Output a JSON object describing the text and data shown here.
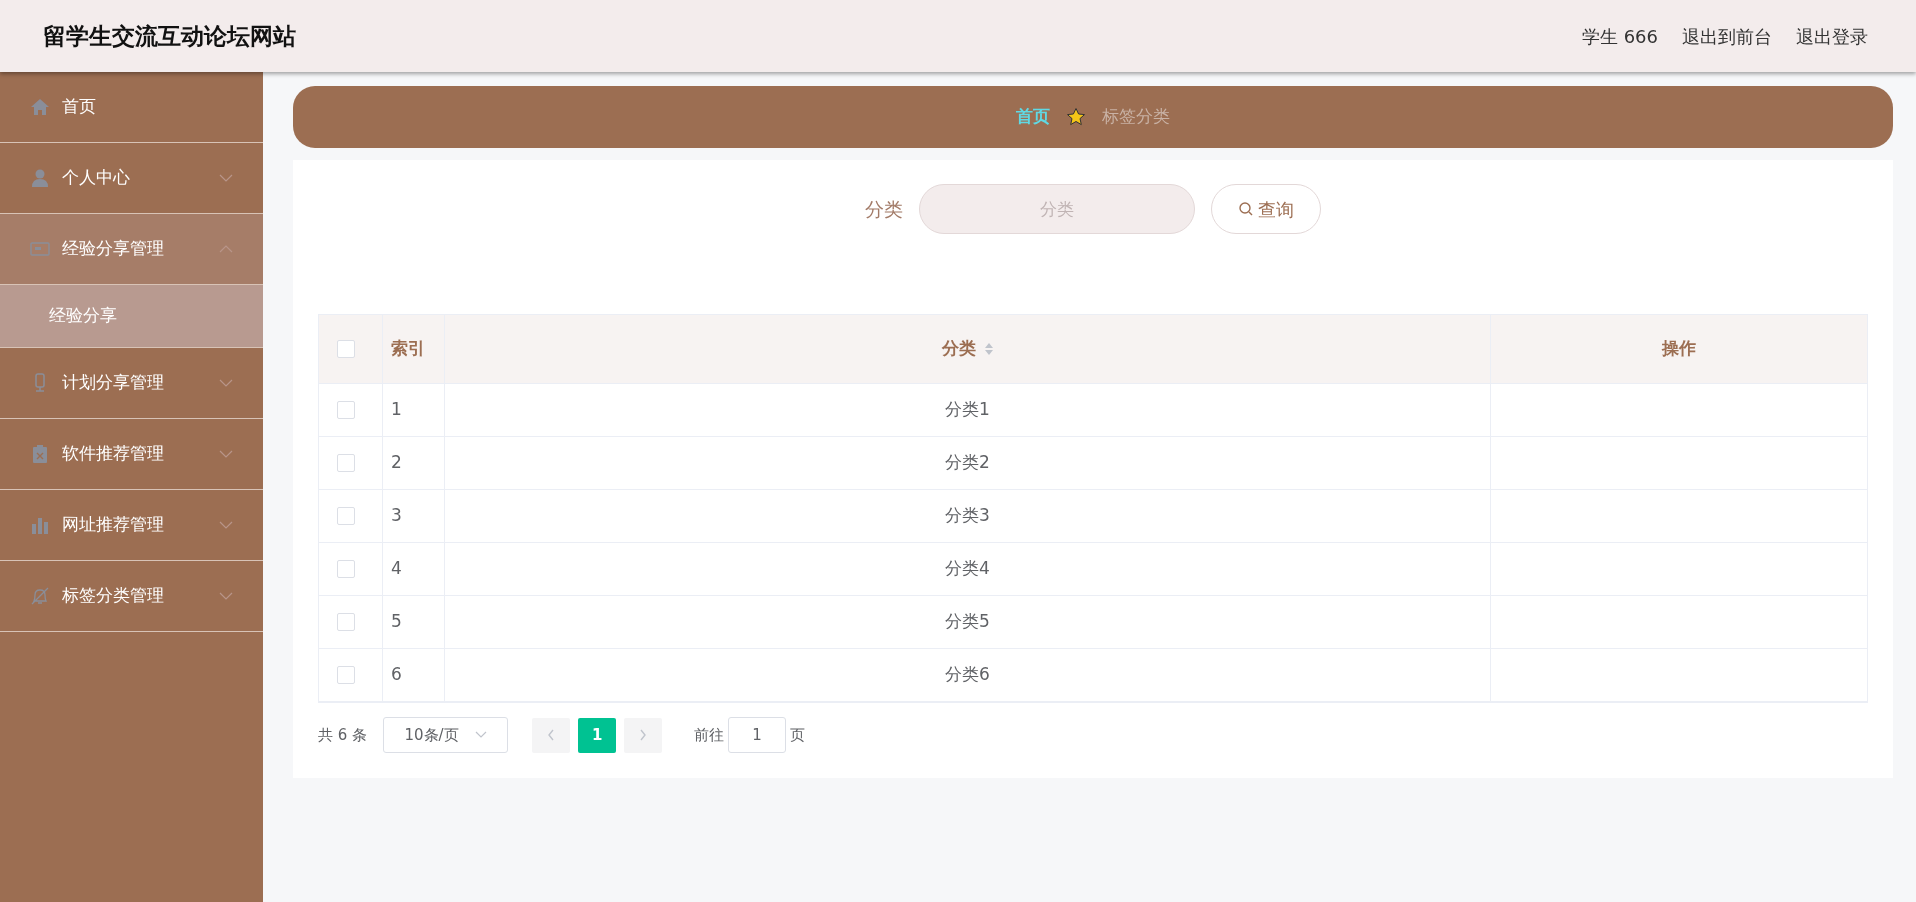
{
  "header": {
    "title": "留学生交流互动论坛网站",
    "links": [
      "学生 666",
      "退出到前台",
      "退出登录"
    ]
  },
  "sidebar": {
    "items": [
      {
        "label": "首页",
        "kind": "link",
        "expanded": false
      },
      {
        "label": "个人中心",
        "kind": "submenu",
        "expanded": false
      },
      {
        "label": "经验分享管理",
        "kind": "submenu",
        "expanded": true,
        "children": [
          {
            "label": "经验分享",
            "selected": true
          }
        ]
      },
      {
        "label": "计划分享管理",
        "kind": "submenu",
        "expanded": false
      },
      {
        "label": "软件推荐管理",
        "kind": "submenu",
        "expanded": false
      },
      {
        "label": "网址推荐管理",
        "kind": "submenu",
        "expanded": false
      },
      {
        "label": "标签分类管理",
        "kind": "submenu",
        "expanded": false
      }
    ]
  },
  "breadcrumb": {
    "home": "首页",
    "current": "标签分类"
  },
  "search": {
    "label": "分类",
    "placeholder": "分类",
    "button": "查询"
  },
  "table": {
    "all_checked": false,
    "columns": [
      "索引",
      "分类",
      "操作"
    ],
    "rows": [
      {
        "checked": false,
        "cells": [
          "1",
          "分类1",
          ""
        ]
      },
      {
        "checked": false,
        "cells": [
          "2",
          "分类2",
          ""
        ]
      },
      {
        "checked": false,
        "cells": [
          "3",
          "分类3",
          ""
        ]
      },
      {
        "checked": false,
        "cells": [
          "4",
          "分类4",
          ""
        ]
      },
      {
        "checked": false,
        "cells": [
          "5",
          "分类5",
          ""
        ]
      },
      {
        "checked": false,
        "cells": [
          "6",
          "分类6",
          ""
        ]
      }
    ]
  },
  "pagination": {
    "total": "共 6 条",
    "page_size": "10条/页",
    "pages": [
      {
        "label": "1",
        "selected": true
      }
    ],
    "goto_label": "前往",
    "goto_value": "1",
    "goto_suffix": "页"
  }
}
